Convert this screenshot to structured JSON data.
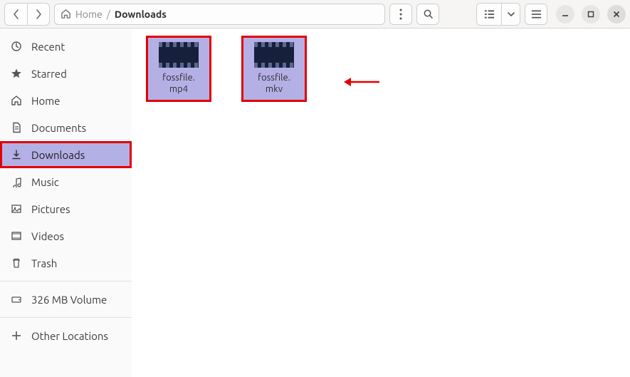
{
  "breadcrumb": {
    "home": "Home",
    "current": "Downloads"
  },
  "sidebar": {
    "items": [
      {
        "label": "Recent"
      },
      {
        "label": "Starred"
      },
      {
        "label": "Home"
      },
      {
        "label": "Documents"
      },
      {
        "label": "Downloads"
      },
      {
        "label": "Music"
      },
      {
        "label": "Pictures"
      },
      {
        "label": "Videos"
      },
      {
        "label": "Trash"
      }
    ],
    "volume": "326 MB Volume",
    "other": "Other Locations"
  },
  "files": [
    {
      "name": "fossfile.\nmp4"
    },
    {
      "name": "fossfile.\nmkv"
    }
  ]
}
